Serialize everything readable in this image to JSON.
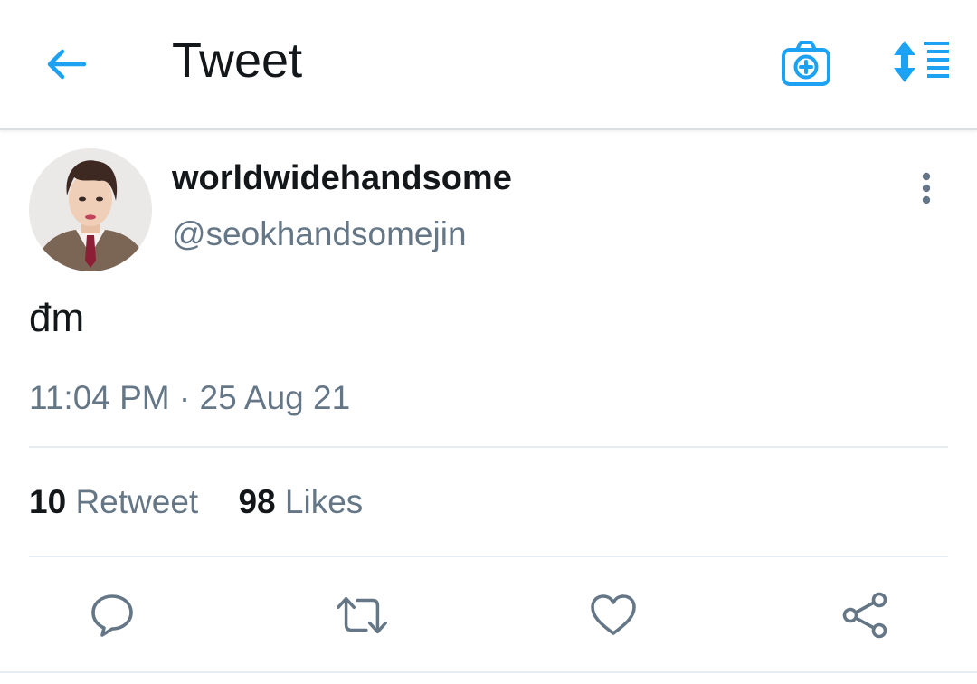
{
  "header": {
    "title": "Tweet",
    "back_icon": "arrow-left-icon",
    "camera_icon": "camera-plus-icon",
    "sort_icon": "sort-list-icon"
  },
  "tweet": {
    "display_name": "worldwidehandsome",
    "handle": "@seokhandsomejin",
    "text": "đm",
    "time": "11:04 PM",
    "separator": "·",
    "date": "25 Aug 21",
    "stats": {
      "retweet_count": "10",
      "retweet_label": "Retweet",
      "like_count": "98",
      "like_label": "Likes"
    }
  },
  "actions": [
    "reply-icon",
    "retweet-icon",
    "like-icon",
    "share-icon"
  ],
  "colors": {
    "accent": "#1da1f2",
    "text_primary": "#14171a",
    "text_secondary": "#657786",
    "divider": "#e6ecf0"
  }
}
